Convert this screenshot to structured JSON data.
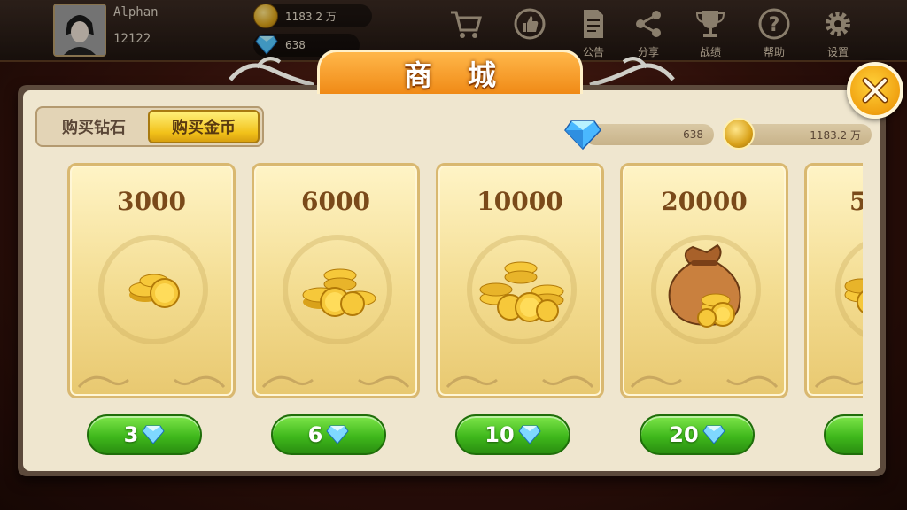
{
  "colors": {
    "accent_orange": "#f08a16",
    "gold": "#f2c21a",
    "green_button": "#3fb81c",
    "panel": "#efe6cf"
  },
  "player": {
    "name": "Alphan",
    "id": "12122",
    "gold": "1183.2 万",
    "diamonds": "638"
  },
  "top_menu": [
    {
      "label": "",
      "icon": "cart-icon"
    },
    {
      "label": "",
      "icon": "thumbs-up-icon"
    },
    {
      "label": "公告",
      "icon": "notice-icon"
    },
    {
      "label": "分享",
      "icon": "share-icon"
    },
    {
      "label": "战绩",
      "icon": "trophy-icon"
    },
    {
      "label": "帮助",
      "icon": "help-icon"
    },
    {
      "label": "设置",
      "icon": "gear-icon"
    }
  ],
  "shop": {
    "title": "商城",
    "tabs": [
      {
        "label": "购买钻石",
        "selected": false
      },
      {
        "label": "购买金币",
        "selected": true
      }
    ],
    "balance_diamonds": "638",
    "balance_gold": "1183.2 万",
    "products": [
      {
        "amount": "3000",
        "price": "3",
        "art": "small-coin-stack-icon"
      },
      {
        "amount": "6000",
        "price": "6",
        "art": "coin-pile-icon"
      },
      {
        "amount": "10000",
        "price": "10",
        "art": "large-coin-pile-icon"
      },
      {
        "amount": "20000",
        "price": "20",
        "art": "money-bag-icon"
      },
      {
        "amount": "5",
        "price": "",
        "art": "coin-pile-icon"
      }
    ]
  }
}
